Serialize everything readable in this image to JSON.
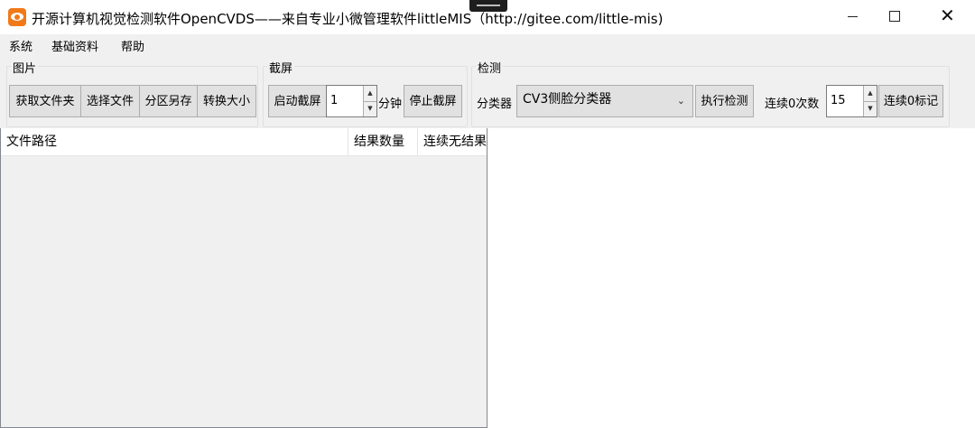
{
  "window": {
    "title": "开源计算机视觉检测软件OpenCVDS——来自专业小微管理软件littleMIS（http://gitee.com/little-mis)",
    "controls": {
      "minimize": "minimize-icon",
      "maximize": "maximize-icon",
      "close": "close-icon"
    },
    "icon": "eye-logo-icon"
  },
  "menu": {
    "items": [
      "系统",
      "基础资料",
      "帮助"
    ]
  },
  "groups": {
    "picture": {
      "title": "图片",
      "buttons": [
        "获取文件夹",
        "选择文件",
        "分区另存",
        "转换大小"
      ]
    },
    "screenshot": {
      "title": "截屏",
      "start_button": "启动截屏",
      "interval_value": "1",
      "interval_unit": "分钟",
      "stop_button": "停止截屏"
    },
    "detect": {
      "title": "检测",
      "classifier_label": "分类器",
      "classifier_value": "CV3侧脸分类器",
      "run_button": "执行检测",
      "count_label": "连续0次数",
      "count_value": "15",
      "mark_button": "连续0标记"
    }
  },
  "table": {
    "columns": [
      "文件路径",
      "结果数量",
      "连续无结果"
    ]
  },
  "colors": {
    "chrome": "#f0f0f0",
    "button": "#e1e1e1",
    "accent_icon": "#f07a1a"
  }
}
